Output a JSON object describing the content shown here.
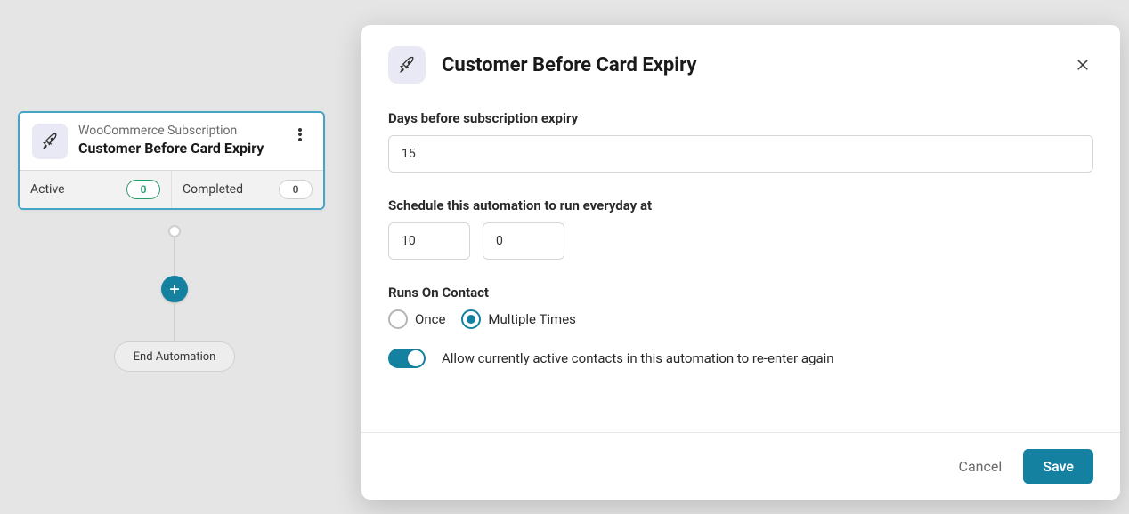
{
  "flow": {
    "node": {
      "subtitle": "WooCommerce Subscription",
      "title": "Customer Before Card Expiry",
      "stats": {
        "active_label": "Active",
        "active_count": "0",
        "completed_label": "Completed",
        "completed_count": "0"
      }
    },
    "end_label": "End Automation"
  },
  "modal": {
    "title": "Customer Before Card Expiry",
    "fields": {
      "days_label": "Days before subscription expiry",
      "days_value": "15",
      "schedule_label": "Schedule this automation to run everyday at",
      "schedule_hour": "10",
      "schedule_minute": "0",
      "runs_label": "Runs On Contact",
      "once_label": "Once",
      "multiple_label": "Multiple Times",
      "runs_selected": "multiple",
      "reenter_label": "Allow currently active contacts in this automation to re-enter again",
      "reenter_on": true
    },
    "buttons": {
      "cancel": "Cancel",
      "save": "Save"
    }
  }
}
